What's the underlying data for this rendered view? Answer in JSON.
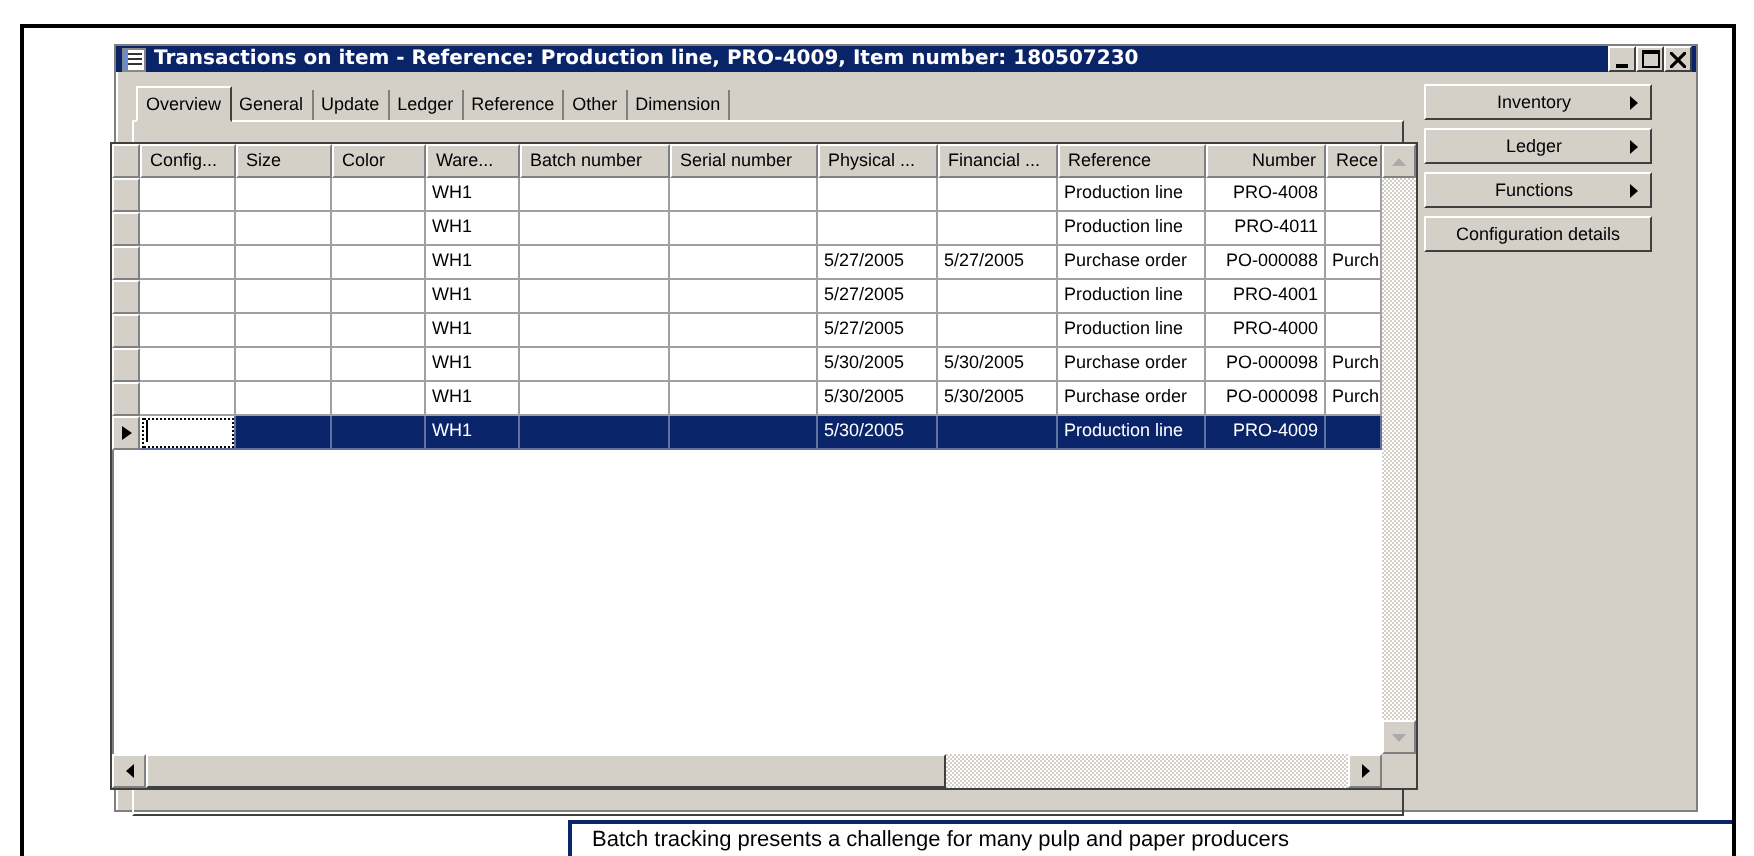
{
  "window": {
    "title": "Transactions on item - Reference: Production line, PRO-4009, Item number: 180507230"
  },
  "tabs": [
    {
      "label": "Overview",
      "selected": true
    },
    {
      "label": "General",
      "selected": false
    },
    {
      "label": "Update",
      "selected": false
    },
    {
      "label": "Ledger",
      "selected": false
    },
    {
      "label": "Reference",
      "selected": false
    },
    {
      "label": "Other",
      "selected": false
    },
    {
      "label": "Dimension",
      "selected": false
    }
  ],
  "table": {
    "columns": [
      "Config...",
      "Size",
      "Color",
      "Ware...",
      "Batch number",
      "Serial number",
      "Physical ...",
      "Financial ...",
      "Reference",
      "Number",
      "Rece"
    ],
    "rows": [
      {
        "selected": false,
        "cells": [
          null,
          null,
          null,
          "WH1",
          null,
          null,
          null,
          null,
          "Production line",
          "PRO-4008",
          null
        ]
      },
      {
        "selected": false,
        "cells": [
          null,
          null,
          null,
          "WH1",
          null,
          null,
          null,
          null,
          "Production line",
          "PRO-4011",
          null
        ]
      },
      {
        "selected": false,
        "cells": [
          null,
          null,
          null,
          "WH1",
          null,
          null,
          "5/27/2005",
          "5/27/2005",
          "Purchase order",
          "PO-000088",
          "Purch"
        ]
      },
      {
        "selected": false,
        "cells": [
          null,
          null,
          null,
          "WH1",
          null,
          null,
          "5/27/2005",
          null,
          "Production line",
          "PRO-4001",
          null
        ]
      },
      {
        "selected": false,
        "cells": [
          null,
          null,
          null,
          "WH1",
          null,
          null,
          "5/27/2005",
          null,
          "Production line",
          "PRO-4000",
          null
        ]
      },
      {
        "selected": false,
        "cells": [
          null,
          null,
          null,
          "WH1",
          null,
          null,
          "5/30/2005",
          "5/30/2005",
          "Purchase order",
          "PO-000098",
          "Purch"
        ]
      },
      {
        "selected": false,
        "cells": [
          null,
          null,
          null,
          "WH1",
          null,
          null,
          "5/30/2005",
          "5/30/2005",
          "Purchase order",
          "PO-000098",
          "Purch"
        ]
      },
      {
        "selected": true,
        "cells": [
          null,
          null,
          null,
          "WH1",
          null,
          null,
          "5/30/2005",
          null,
          "Production line",
          "PRO-4009",
          null
        ]
      }
    ]
  },
  "buttons": [
    {
      "label": "Inventory",
      "submenu": true
    },
    {
      "label": "Ledger",
      "submenu": true
    },
    {
      "label": "Functions",
      "submenu": true
    },
    {
      "label": "Configuration details",
      "submenu": false
    }
  ],
  "callout": {
    "text": "Batch tracking presents a challenge for many pulp and paper producers"
  }
}
